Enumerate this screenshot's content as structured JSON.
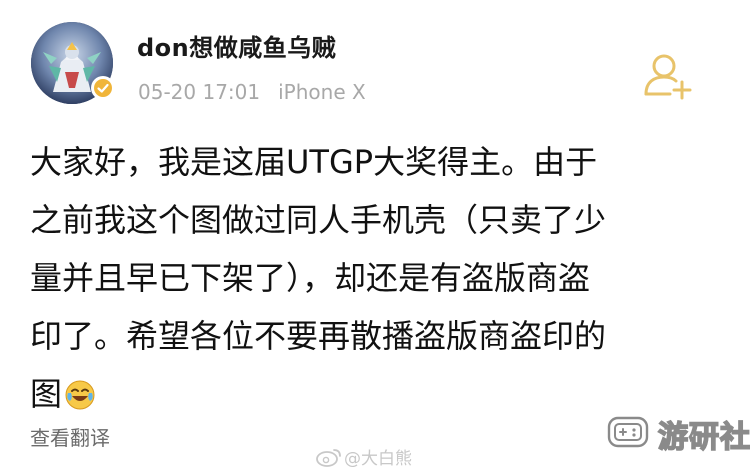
{
  "post": {
    "username": "don想做咸鱼乌贼",
    "date": "05-20 17:01",
    "device": "iPhone X",
    "content_lines": [
      "大家好，我是这届UTGP大奖得主。由于",
      "之前我这个图做过同人手机壳（只卖了少",
      "量并且早已下架了），却还是有盗版商盗",
      "印了。希望各位不要再散播盗版商盗印的",
      "图"
    ],
    "translate_label": "查看翻译"
  },
  "icons": {
    "avatar": "avatar-image",
    "verified": "verified-badge-icon",
    "follow": "add-user-icon",
    "emoji": "crying-laughing-emoji-icon"
  },
  "colors": {
    "follow_icon": "#e8c36a",
    "meta_text": "#a8a8a8",
    "badge": "#f0b53a"
  },
  "watermarks": {
    "weibo": "@大白熊",
    "site": "游研社"
  }
}
